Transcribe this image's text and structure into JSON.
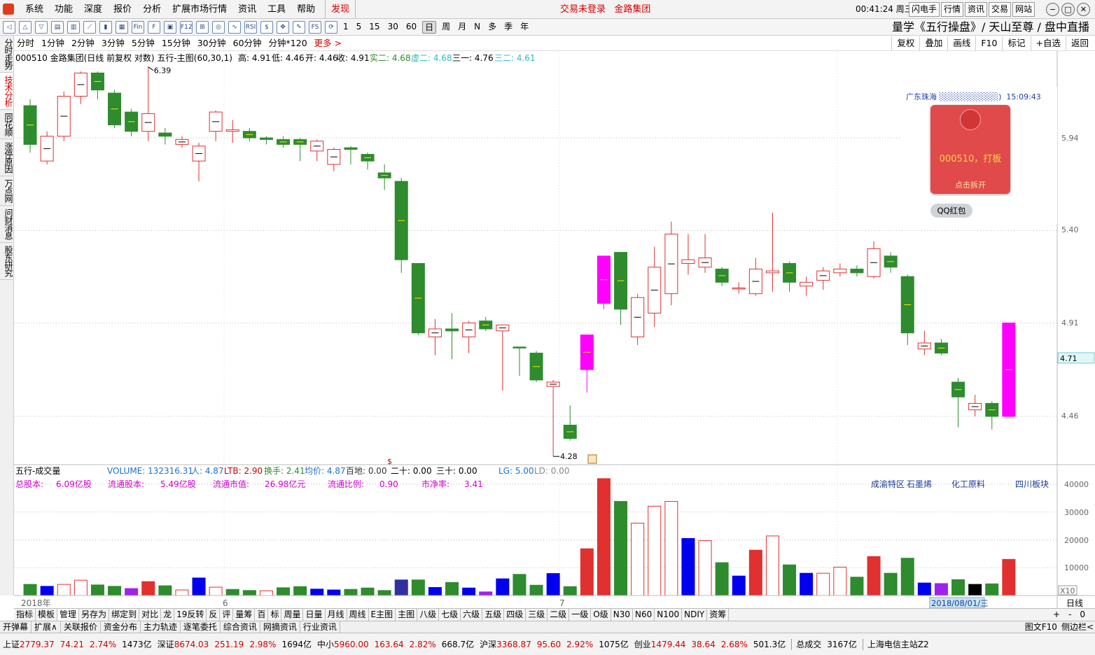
{
  "menu": {
    "items": [
      "系统",
      "功能",
      "深度",
      "报价",
      "分析",
      "扩展市场行情",
      "资讯",
      "工具",
      "帮助"
    ],
    "highlight": "发现",
    "trade_status": "交易未登录",
    "stock_name_link": "金路集团",
    "clock": "00:41:24 周三",
    "top_buttons": [
      "闪电手",
      "行情",
      "资讯",
      "交易",
      "网站"
    ]
  },
  "toolbar": {
    "periods": [
      "1",
      "5",
      "15",
      "30",
      "60",
      "日",
      "周",
      "月",
      "N",
      "多",
      "季",
      "年"
    ],
    "slogan": "量学《五行操盘》/ 天山至尊 / 盘中直播"
  },
  "period_bar": {
    "items": [
      "分时",
      "1分钟",
      "2分钟",
      "3分钟",
      "5分钟",
      "15分钟",
      "30分钟",
      "60分钟",
      "分钟*120"
    ],
    "more": "更多 >",
    "right_buttons": [
      "复权",
      "叠加",
      "画线",
      "F10",
      "标记",
      "+自选",
      "返回"
    ]
  },
  "sidebar": {
    "tabs": [
      "分时走势",
      "技术分析",
      "同花顺",
      "涨停原因",
      "万点网",
      "问财消息",
      "股东研究"
    ],
    "active": 1
  },
  "main_info": {
    "title": "000510 金路集团(日线 前复权 对数) 五行-主图(60,30,1)",
    "high": "高: 4.91",
    "low": "低: 4.46",
    "open": "开: 4.46",
    "close": "收: 4.91",
    "shi2": "实二: 4.68",
    "xu2": "虚二: 4.68",
    "san1": "三一: 4.76",
    "san2": "三二: 4.61",
    "max_label": "6.39",
    "min_label": "4.28"
  },
  "price_axis": {
    "ticks": [
      "5.94",
      "5.40",
      "4.91",
      "4.46"
    ],
    "current": "4.71"
  },
  "volume_info": {
    "title": "五行-成交量",
    "volume": "VOLUME: 132316.31",
    "ren": "人: 4.87",
    "ltb": "LTB: 2.90",
    "turnover": "换手: 2.41",
    "avg": "均价: 4.87",
    "baidi": "百地: 0.00",
    "ershi": "二十: 0.00",
    "sanshi": "三十: 0.00",
    "lg": "LG: 5.00",
    "ld": "LD: 0.00",
    "total_shares_label": "总股本:",
    "total_shares": "6.09亿股",
    "float_shares_label": "流通股本:",
    "float_shares": "5.49亿股",
    "float_value_label": "流通市值:",
    "float_value": "26.98亿元",
    "float_ratio_label": "流通比例:",
    "float_ratio": "0.90",
    "pb_label": "市净率:",
    "pb": "3.41",
    "concepts": [
      "成渝特区",
      "石墨烯",
      "化工原料",
      "四川板块"
    ]
  },
  "volume_axis": {
    "ticks": [
      "40000",
      "30000",
      "20000",
      "10000"
    ],
    "unit": "X10"
  },
  "date_axis": {
    "labels": [
      "2018年",
      "6",
      "7"
    ],
    "cursor_date": "2018/08/01/三",
    "period": "日线"
  },
  "qq_popup": {
    "title": "广东珠海",
    "time": "15:09:43",
    "message": "000510，打板",
    "open": "点击拆开",
    "button": "QQ红包"
  },
  "bottom_tabs": [
    "指标",
    "模板",
    "管理",
    "另存为",
    "绑定到",
    "对比",
    "龙",
    "19反转",
    "反",
    "评",
    "量筹",
    "百",
    "标",
    "周量",
    "日量",
    "月线",
    "周线",
    "E主图",
    "主图",
    "八级",
    "七级",
    "六级",
    "五级",
    "四级",
    "三级",
    "二级",
    "一级",
    "O级",
    "N30",
    "N60",
    "N100",
    "NDIY",
    "资筹"
  ],
  "bottom_tabs_right": [
    "日线",
    "+",
    "-",
    "0"
  ],
  "func_bar": {
    "items": [
      "开弹幕",
      "扩展∧",
      "关联报价",
      "资金分布",
      "主力轨迹",
      "逐笔委托",
      "综合资讯",
      "网摘资讯",
      "行业资讯"
    ],
    "right": [
      "图文F10",
      "侧边栏<"
    ]
  },
  "status": {
    "sh_label": "上证",
    "sh": "2779.37",
    "sh_chg": "74.21",
    "sh_pct": "2.74%",
    "sh_amt": "1473亿",
    "sz_label": "深证",
    "sz": "8674.03",
    "sz_chg": "251.19",
    "sz_pct": "2.98%",
    "sz_amt": "1694亿",
    "zx_label": "中小",
    "zx": "5960.00",
    "zx_chg": "163.64",
    "zx_pct": "2.82%",
    "zx_amt": "668.7亿",
    "hs_label": "沪深",
    "hs": "3368.87",
    "hs_chg": "95.60",
    "hs_pct": "2.92%",
    "hs_amt": "1075亿",
    "cy_label": "创业",
    "cy": "1479.44",
    "cy_chg": "38.64",
    "cy_pct": "2.68%",
    "cy_amt": "501.3亿",
    "total_label": "总成交",
    "total": "3167亿",
    "server": "上海电信主站Z2"
  },
  "chart_data": {
    "type": "candlestick",
    "colors": {
      "up": "#e03030",
      "down": "#2e8b2e",
      "special": "#ff00ff",
      "vol_blue": "#0000ee",
      "vol_purple": "#a020f0"
    },
    "candles": [
      {
        "o": 5.9,
        "c": 6.14,
        "h": 6.18,
        "l": 5.85,
        "t": "down"
      },
      {
        "o": 5.8,
        "c": 5.95,
        "h": 5.98,
        "l": 5.78,
        "t": "up"
      },
      {
        "o": 5.95,
        "c": 6.2,
        "h": 6.23,
        "l": 5.92,
        "t": "up"
      },
      {
        "o": 6.2,
        "c": 6.35,
        "h": 6.36,
        "l": 6.15,
        "t": "up"
      },
      {
        "o": 6.35,
        "c": 6.24,
        "h": 6.36,
        "l": 6.18,
        "t": "down"
      },
      {
        "o": 6.22,
        "c": 6.02,
        "h": 6.24,
        "l": 6.0,
        "t": "down"
      },
      {
        "o": 6.1,
        "c": 5.98,
        "h": 6.12,
        "l": 5.95,
        "t": "down"
      },
      {
        "o": 5.98,
        "c": 6.09,
        "h": 6.39,
        "l": 5.92,
        "t": "up"
      },
      {
        "o": 5.97,
        "c": 5.95,
        "h": 6.0,
        "l": 5.9,
        "t": "down"
      },
      {
        "o": 5.93,
        "c": 5.9,
        "h": 5.95,
        "l": 5.88,
        "t": "up"
      },
      {
        "o": 5.89,
        "c": 5.8,
        "h": 5.91,
        "l": 5.68,
        "t": "up"
      },
      {
        "o": 5.98,
        "c": 6.1,
        "h": 6.11,
        "l": 5.92,
        "t": "up"
      },
      {
        "o": 5.98,
        "c": 5.99,
        "h": 6.05,
        "l": 5.91,
        "t": "up"
      },
      {
        "o": 5.98,
        "c": 5.94,
        "h": 6.0,
        "l": 5.92,
        "t": "down"
      },
      {
        "o": 5.94,
        "c": 5.93,
        "h": 5.95,
        "l": 5.9,
        "t": "down"
      },
      {
        "o": 5.93,
        "c": 5.9,
        "h": 5.95,
        "l": 5.88,
        "t": "down"
      },
      {
        "o": 5.93,
        "c": 5.9,
        "h": 5.94,
        "l": 5.8,
        "t": "down"
      },
      {
        "o": 5.92,
        "c": 5.86,
        "h": 5.93,
        "l": 5.8,
        "t": "up"
      },
      {
        "o": 5.87,
        "c": 5.78,
        "h": 5.88,
        "l": 5.74,
        "t": "up"
      },
      {
        "o": 5.88,
        "c": 5.87,
        "h": 5.89,
        "l": 5.78,
        "t": "down"
      },
      {
        "o": 5.84,
        "c": 5.8,
        "h": 5.85,
        "l": 5.75,
        "t": "down"
      },
      {
        "o": 5.73,
        "c": 5.7,
        "h": 5.78,
        "l": 5.63,
        "t": "down"
      },
      {
        "o": 5.68,
        "c": 5.24,
        "h": 5.7,
        "l": 5.17,
        "t": "down"
      },
      {
        "o": 5.22,
        "c": 4.86,
        "h": 5.22,
        "l": 4.85,
        "t": "down"
      },
      {
        "o": 4.84,
        "c": 4.88,
        "h": 4.93,
        "l": 4.75,
        "t": "up"
      },
      {
        "o": 4.87,
        "c": 4.88,
        "h": 4.96,
        "l": 4.73,
        "t": "down"
      },
      {
        "o": 4.84,
        "c": 4.91,
        "h": 4.92,
        "l": 4.76,
        "t": "up"
      },
      {
        "o": 4.92,
        "c": 4.88,
        "h": 4.94,
        "l": 4.87,
        "t": "down"
      },
      {
        "o": 4.87,
        "c": 4.9,
        "h": 4.9,
        "l": 4.58,
        "t": "up"
      },
      {
        "o": 4.79,
        "c": 4.79,
        "h": 4.79,
        "l": 4.65,
        "t": "down"
      },
      {
        "o": 4.76,
        "c": 4.63,
        "h": 4.77,
        "l": 4.62,
        "t": "down"
      },
      {
        "o": 4.6,
        "c": 4.62,
        "h": 4.63,
        "l": 4.28,
        "t": "up"
      },
      {
        "o": 4.42,
        "c": 4.36,
        "h": 4.51,
        "l": 4.35,
        "t": "down"
      },
      {
        "o": 4.68,
        "c": 4.85,
        "h": 4.85,
        "l": 4.57,
        "t": "special"
      },
      {
        "o": 5.01,
        "c": 5.26,
        "h": 5.26,
        "l": 4.98,
        "t": "special"
      },
      {
        "o": 5.28,
        "c": 4.98,
        "h": 5.28,
        "l": 4.9,
        "t": "down"
      },
      {
        "o": 4.84,
        "c": 5.04,
        "h": 5.06,
        "l": 4.8,
        "t": "up"
      },
      {
        "o": 4.96,
        "c": 5.2,
        "h": 5.31,
        "l": 4.89,
        "t": "up"
      },
      {
        "o": 5.06,
        "c": 5.38,
        "h": 5.45,
        "l": 5.0,
        "t": "up"
      },
      {
        "o": 5.22,
        "c": 5.24,
        "h": 5.38,
        "l": 5.16,
        "t": "up"
      },
      {
        "o": 5.2,
        "c": 5.25,
        "h": 5.38,
        "l": 5.17,
        "t": "up"
      },
      {
        "o": 5.19,
        "c": 5.12,
        "h": 5.2,
        "l": 5.1,
        "t": "down"
      },
      {
        "o": 5.09,
        "c": 5.09,
        "h": 5.12,
        "l": 5.06,
        "t": "up"
      },
      {
        "o": 5.06,
        "c": 5.19,
        "h": 5.25,
        "l": 5.05,
        "t": "up"
      },
      {
        "o": 5.17,
        "c": 5.18,
        "h": 5.5,
        "l": 5.07,
        "t": "up"
      },
      {
        "o": 5.22,
        "c": 5.12,
        "h": 5.23,
        "l": 5.07,
        "t": "down"
      },
      {
        "o": 5.1,
        "c": 5.12,
        "h": 5.15,
        "l": 5.05,
        "t": "up"
      },
      {
        "o": 5.13,
        "c": 5.18,
        "h": 5.2,
        "l": 5.08,
        "t": "up"
      },
      {
        "o": 5.17,
        "c": 5.19,
        "h": 5.22,
        "l": 5.15,
        "t": "up"
      },
      {
        "o": 5.19,
        "c": 5.17,
        "h": 5.21,
        "l": 5.15,
        "t": "down"
      },
      {
        "o": 5.15,
        "c": 5.3,
        "h": 5.34,
        "l": 5.14,
        "t": "up"
      },
      {
        "o": 5.26,
        "c": 5.2,
        "h": 5.28,
        "l": 5.17,
        "t": "down"
      },
      {
        "o": 5.15,
        "c": 4.86,
        "h": 5.16,
        "l": 4.8,
        "t": "down"
      },
      {
        "o": 4.81,
        "c": 4.78,
        "h": 4.87,
        "l": 4.75,
        "t": "up"
      },
      {
        "o": 4.81,
        "c": 4.76,
        "h": 4.83,
        "l": 4.75,
        "t": "down"
      },
      {
        "o": 4.62,
        "c": 4.55,
        "h": 4.64,
        "l": 4.41,
        "t": "down"
      },
      {
        "o": 4.52,
        "c": 4.49,
        "h": 4.56,
        "l": 4.46,
        "t": "up"
      },
      {
        "o": 4.52,
        "c": 4.46,
        "h": 4.53,
        "l": 4.4,
        "t": "down"
      },
      {
        "o": 4.46,
        "c": 4.91,
        "h": 4.91,
        "l": 4.46,
        "t": "special"
      }
    ],
    "volume": [
      {
        "v": 4000,
        "t": "down"
      },
      {
        "v": 3300,
        "t": "blue"
      },
      {
        "v": 4000,
        "t": "up"
      },
      {
        "v": 5500,
        "t": "up"
      },
      {
        "v": 3800,
        "t": "down"
      },
      {
        "v": 3300,
        "t": "down"
      },
      {
        "v": 2500,
        "t": "purple"
      },
      {
        "v": 5000,
        "t": "red"
      },
      {
        "v": 3500,
        "t": "down"
      },
      {
        "v": 2000,
        "t": "up"
      },
      {
        "v": 6300,
        "t": "blue"
      },
      {
        "v": 3000,
        "t": "up"
      },
      {
        "v": 2200,
        "t": "down"
      },
      {
        "v": 1800,
        "t": "down"
      },
      {
        "v": 1700,
        "t": "up"
      },
      {
        "v": 2800,
        "t": "down"
      },
      {
        "v": 3200,
        "t": "down"
      },
      {
        "v": 2300,
        "t": "blue"
      },
      {
        "v": 2000,
        "t": "blue"
      },
      {
        "v": 2200,
        "t": "down"
      },
      {
        "v": 2700,
        "t": "down"
      },
      {
        "v": 1800,
        "t": "down"
      },
      {
        "v": 5600,
        "t": "navy"
      },
      {
        "v": 5600,
        "t": "down"
      },
      {
        "v": 2900,
        "t": "blue"
      },
      {
        "v": 4700,
        "t": "down"
      },
      {
        "v": 2700,
        "t": "blue"
      },
      {
        "v": 1300,
        "t": "purple"
      },
      {
        "v": 6000,
        "t": "blue"
      },
      {
        "v": 7600,
        "t": "down"
      },
      {
        "v": 3700,
        "t": "down"
      },
      {
        "v": 7900,
        "t": "blue"
      },
      {
        "v": 3200,
        "t": "down"
      },
      {
        "v": 16800,
        "t": "red"
      },
      {
        "v": 42000,
        "t": "red"
      },
      {
        "v": 33800,
        "t": "down"
      },
      {
        "v": 26000,
        "t": "up"
      },
      {
        "v": 32100,
        "t": "up"
      },
      {
        "v": 33800,
        "t": "up"
      },
      {
        "v": 20500,
        "t": "blue"
      },
      {
        "v": 19700,
        "t": "up"
      },
      {
        "v": 11800,
        "t": "down"
      },
      {
        "v": 7000,
        "t": "blue"
      },
      {
        "v": 16300,
        "t": "red"
      },
      {
        "v": 21400,
        "t": "up"
      },
      {
        "v": 11000,
        "t": "down"
      },
      {
        "v": 8000,
        "t": "blue"
      },
      {
        "v": 8000,
        "t": "up"
      },
      {
        "v": 10200,
        "t": "up"
      },
      {
        "v": 6600,
        "t": "down"
      },
      {
        "v": 14000,
        "t": "red"
      },
      {
        "v": 8000,
        "t": "down"
      },
      {
        "v": 13400,
        "t": "down"
      },
      {
        "v": 4500,
        "t": "blue"
      },
      {
        "v": 4300,
        "t": "purple"
      },
      {
        "v": 5700,
        "t": "down"
      },
      {
        "v": 4000,
        "t": "black"
      },
      {
        "v": 4200,
        "t": "down"
      },
      {
        "v": 13000,
        "t": "red"
      }
    ],
    "price_ticks": [
      5.94,
      5.4,
      4.91,
      4.46
    ],
    "volume_ticks": [
      40000,
      30000,
      20000,
      10000
    ],
    "log_scale": true,
    "grid": true
  }
}
